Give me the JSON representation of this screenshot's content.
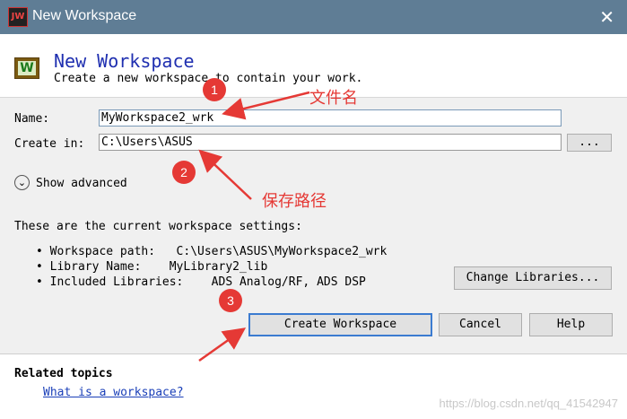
{
  "window": {
    "title": "New Workspace",
    "app_icon_text": "JW"
  },
  "header": {
    "title": "New Workspace",
    "subtitle": "Create a new workspace to contain your work."
  },
  "form": {
    "name_label": "Name:",
    "name_value": "MyWorkspace2_wrk",
    "create_in_label": "Create in:",
    "create_in_value": "C:\\Users\\ASUS",
    "browse_label": "...",
    "show_advanced_label": "Show advanced"
  },
  "settings": {
    "heading": "These are the current workspace settings:",
    "items": [
      "Workspace path:   C:\\Users\\ASUS\\MyWorkspace2_wrk",
      "Library Name:    MyLibrary2_lib",
      "Included Libraries:    ADS Analog/RF, ADS DSP"
    ],
    "change_libraries_label": "Change Libraries..."
  },
  "buttons": {
    "create": "Create Workspace",
    "cancel": "Cancel",
    "help": "Help"
  },
  "related": {
    "heading": "Related topics",
    "link": "What is a workspace?"
  },
  "annotations": {
    "badges": [
      "1",
      "2",
      "3"
    ],
    "file_name_note": "文件名",
    "save_path_note": "保存路径",
    "color": "#e53935"
  },
  "watermark": "https://blog.csdn.net/qq_41542947"
}
